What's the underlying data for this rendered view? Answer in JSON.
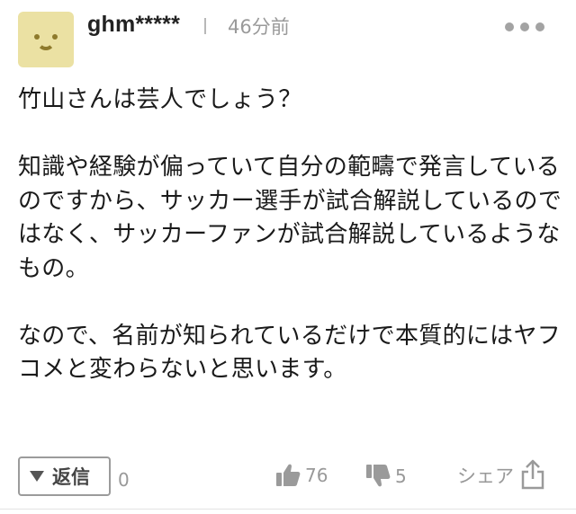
{
  "comment": {
    "username": "ghm*****",
    "timestamp": "46分前",
    "body": "竹山さんは芸人でしょう？\n\n知識や経験が偏っていて自分の範疇で発言しているのですから、サッカー選手が試合解説しているのではなく、サッカーファンが試合解説しているようなもの。\n\nなので、名前が知られているだけで本質的にはヤフコメと変わらないと思います。"
  },
  "footer": {
    "reply_label": "返信",
    "reply_count": "0",
    "like_count": "76",
    "dislike_count": "5",
    "share_label": "シェア"
  },
  "colors": {
    "avatar_bg": "#ebe1a3",
    "avatar_face": "#8e7a2c",
    "muted": "#999999"
  }
}
